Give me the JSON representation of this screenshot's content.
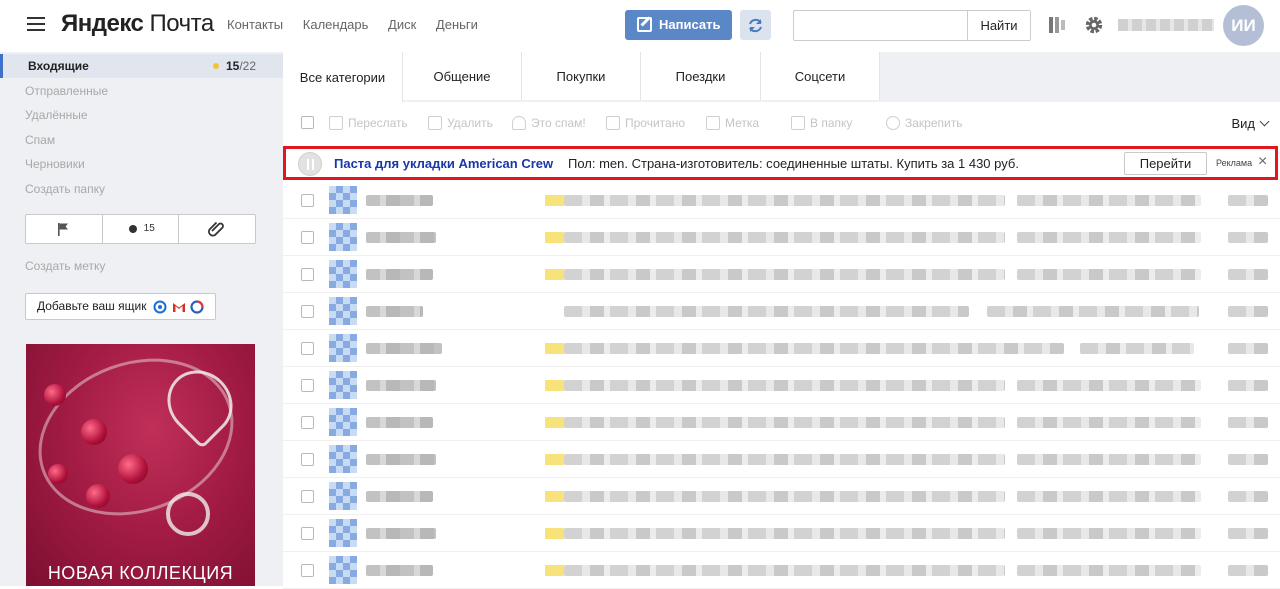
{
  "header": {
    "logo_part1": "Яндекс",
    "logo_part2": "Почта",
    "nav": [
      "Контакты",
      "Календарь",
      "Диск",
      "Деньги"
    ],
    "compose_label": "Написать",
    "search_value": "",
    "search_button": "Найти",
    "avatar_initials": "ИИ"
  },
  "sidebar": {
    "inbox_label": "Входящие",
    "inbox_unread": "15",
    "inbox_total": "/22",
    "folders": [
      "Отправленные",
      "Удалённые",
      "Спам",
      "Черновики",
      "Создать папку"
    ],
    "unread_filter_count": "15",
    "create_label": "Создать метку",
    "add_mailbox": "Добавьте ваш ящик",
    "ad_banner_text": "НОВАЯ КОЛЛЕКЦИЯ"
  },
  "tabs": [
    "Все категории",
    "Общение",
    "Покупки",
    "Поездки",
    "Соцсети"
  ],
  "toolbar": {
    "forward": "Переслать",
    "delete": "Удалить",
    "spam": "Это спам!",
    "read": "Прочитано",
    "label": "Метка",
    "to_folder": "В папку",
    "pin": "Закрепить",
    "view": "Вид"
  },
  "ad": {
    "title": "Паста для укладки American Crew",
    "text": "Пол: men. Страна-изготовитель: соединенные штаты. Купить за 1 430 руб.",
    "go": "Перейти",
    "label": "Реклама",
    "close": "×"
  },
  "colors": {
    "accent_blue": "#5a88c7",
    "ad_border": "#e0171e",
    "sidebar_bg": "#eef0f3",
    "unread_dot": "#f2c230"
  },
  "messages_count": 11
}
